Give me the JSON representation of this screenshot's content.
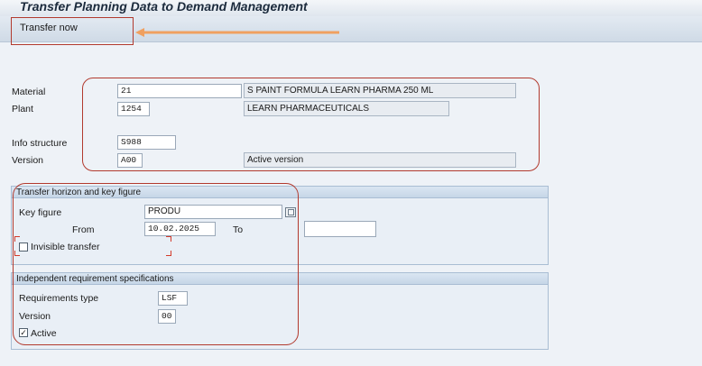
{
  "window": {
    "title": "Transfer Planning Data to Demand Management"
  },
  "toolbar": {
    "transfer_now_label": "Transfer now"
  },
  "header_fields": {
    "material_label": "Material",
    "material_value": "21",
    "material_description": "S PAINT FORMULA LEARN PHARMA 250 ML",
    "plant_label": "Plant",
    "plant_value": "1254",
    "plant_description": "LEARN PHARMACEUTICALS",
    "info_structure_label": "Info structure",
    "info_structure_value": "S988",
    "version_label": "Version",
    "version_value": "A00",
    "version_description": "Active version"
  },
  "transfer_group": {
    "title": "Transfer horizon and key figure",
    "key_figure_label": "Key figure",
    "key_figure_value": "PRODU",
    "from_label": "From",
    "from_value": "10.02.2025",
    "to_label": "To",
    "to_value": "",
    "invisible_transfer_label": "Invisible transfer",
    "invisible_transfer_checked": false
  },
  "requirements_group": {
    "title": "Independent requirement specifications",
    "requirements_type_label": "Requirements type",
    "requirements_type_value": "LSF",
    "version_label": "Version",
    "version_value": "00",
    "active_label": "Active",
    "active_checked": true,
    "active_mark": "✓"
  },
  "colors": {
    "annotation_red": "#b23a2e",
    "annotation_arrow": "#f0a060"
  }
}
